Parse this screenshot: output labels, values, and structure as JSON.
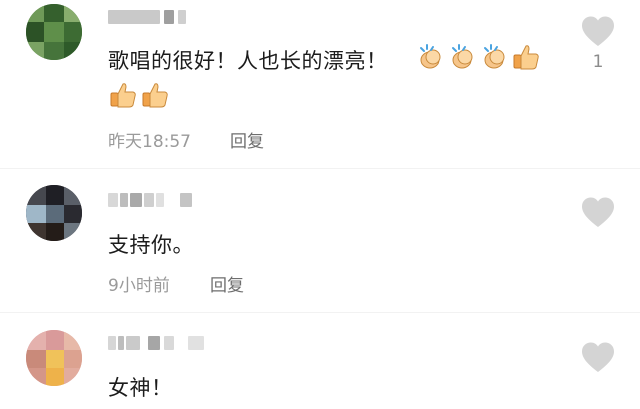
{
  "comments": [
    {
      "username": "",
      "text": "歌唱的很好！人也长的漂亮！",
      "emoji_inline": [
        "clapping-hands",
        "clapping-hands",
        "clapping-hands",
        "thumbs-up"
      ],
      "emoji_second_line": [
        "thumbs-up",
        "thumbs-up"
      ],
      "time": "昨天18:57",
      "reply_label": "回复",
      "like_count": "1",
      "avatar_colors": [
        "#3d6b33",
        "#5f8f4a",
        "#2c5226",
        "#7aa363"
      ]
    },
    {
      "username": "",
      "text": "支持你。",
      "time": "9小时前",
      "reply_label": "回复",
      "like_count": "",
      "avatar_colors": [
        "#2a2a30",
        "#5b6b7a",
        "#9fb7c8",
        "#3f3530"
      ]
    },
    {
      "username": "",
      "text": "女神！",
      "time": "",
      "reply_label": "",
      "like_count": "",
      "avatar_colors": [
        "#d99a9a",
        "#e7b9a8",
        "#f0c25a",
        "#c98a7a"
      ]
    }
  ],
  "colors": {
    "heart": "#d4d4d4",
    "text": "#1c1c1c",
    "meta": "#9a9a9a",
    "reply": "#6e6e6e"
  }
}
